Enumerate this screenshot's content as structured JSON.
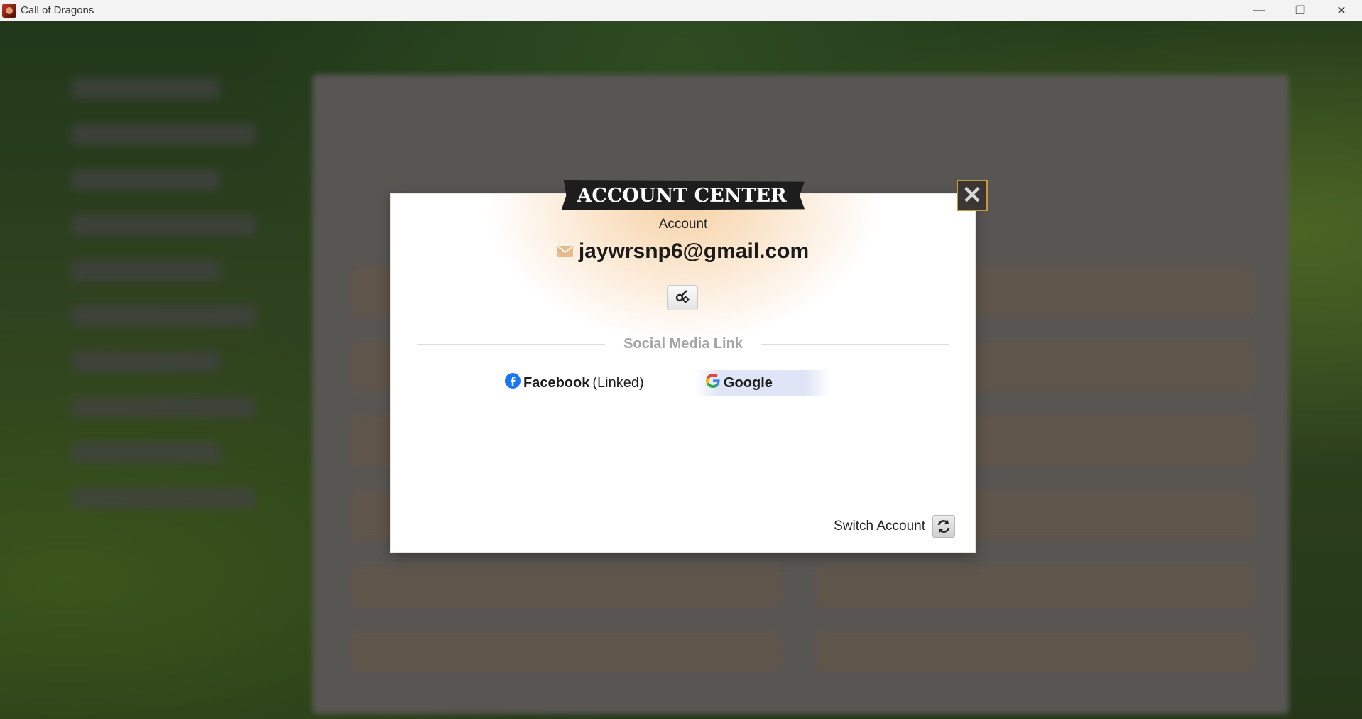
{
  "window": {
    "title": "Call of Dragons",
    "minimize_glyph": "—",
    "restore_glyph": "❐",
    "close_glyph": "✕"
  },
  "dialog": {
    "title": "ACCOUNT CENTER",
    "close_glyph": "✕",
    "account_label": "Account",
    "email": "jaywrsnp6@gmail.com",
    "settings_icon": "account-settings-icon",
    "social_section_title": "Social Media Link",
    "facebook": {
      "name": "Facebook",
      "status": "(Linked)"
    },
    "google": {
      "name": "Google"
    },
    "switch_account_label": "Switch Account",
    "colors": {
      "banner": "#1d1d1d",
      "close_border": "#c49a3a",
      "glow": "#f6d2a6",
      "facebook_blue": "#1877f2"
    }
  }
}
